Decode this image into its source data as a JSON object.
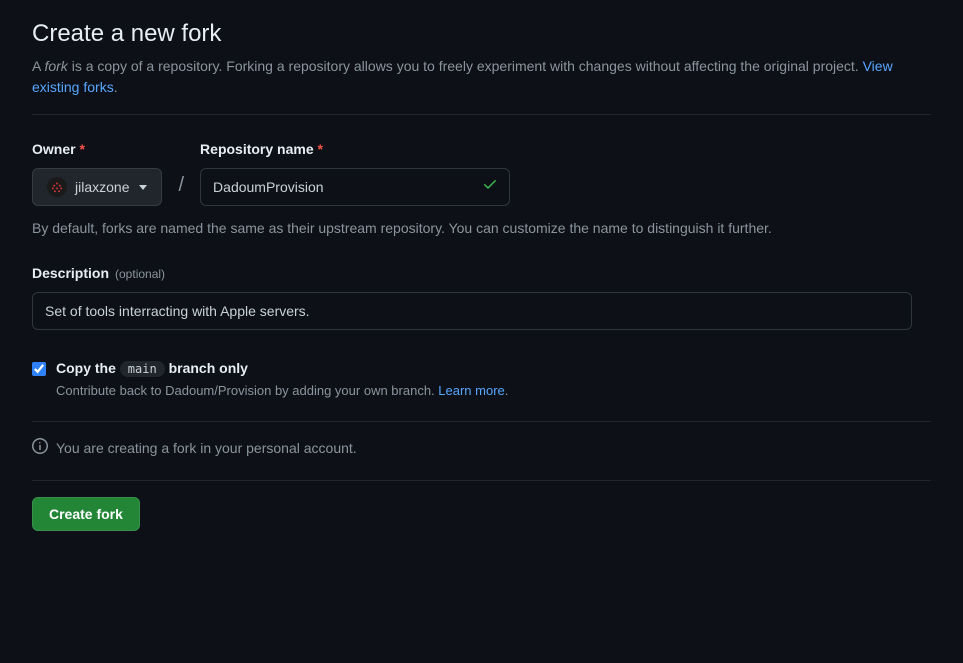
{
  "title": "Create a new fork",
  "subtitle": {
    "prefix": "A ",
    "italic": "fork",
    "rest": " is a copy of a repository. Forking a repository allows you to freely experiment with changes without affecting the original project. ",
    "link": "View existing forks",
    "period": "."
  },
  "owner": {
    "label": "Owner",
    "value": "jilaxzone"
  },
  "repo": {
    "label": "Repository name",
    "value": "DadoumProvision"
  },
  "slash": "/",
  "required_marker": "*",
  "help_text": "By default, forks are named the same as their upstream repository. You can customize the name to distinguish it further.",
  "description": {
    "label": "Description",
    "optional": "(optional)",
    "value": "Set of tools interracting with Apple servers."
  },
  "copy_branch": {
    "checked": true,
    "label_prefix": "Copy the ",
    "branch": "main",
    "label_suffix": " branch only",
    "sub_prefix": "Contribute back to Dadoum/Provision by adding your own branch. ",
    "learn_more": "Learn more",
    "sub_period": "."
  },
  "info_text": "You are creating a fork in your personal account.",
  "submit_label": "Create fork"
}
